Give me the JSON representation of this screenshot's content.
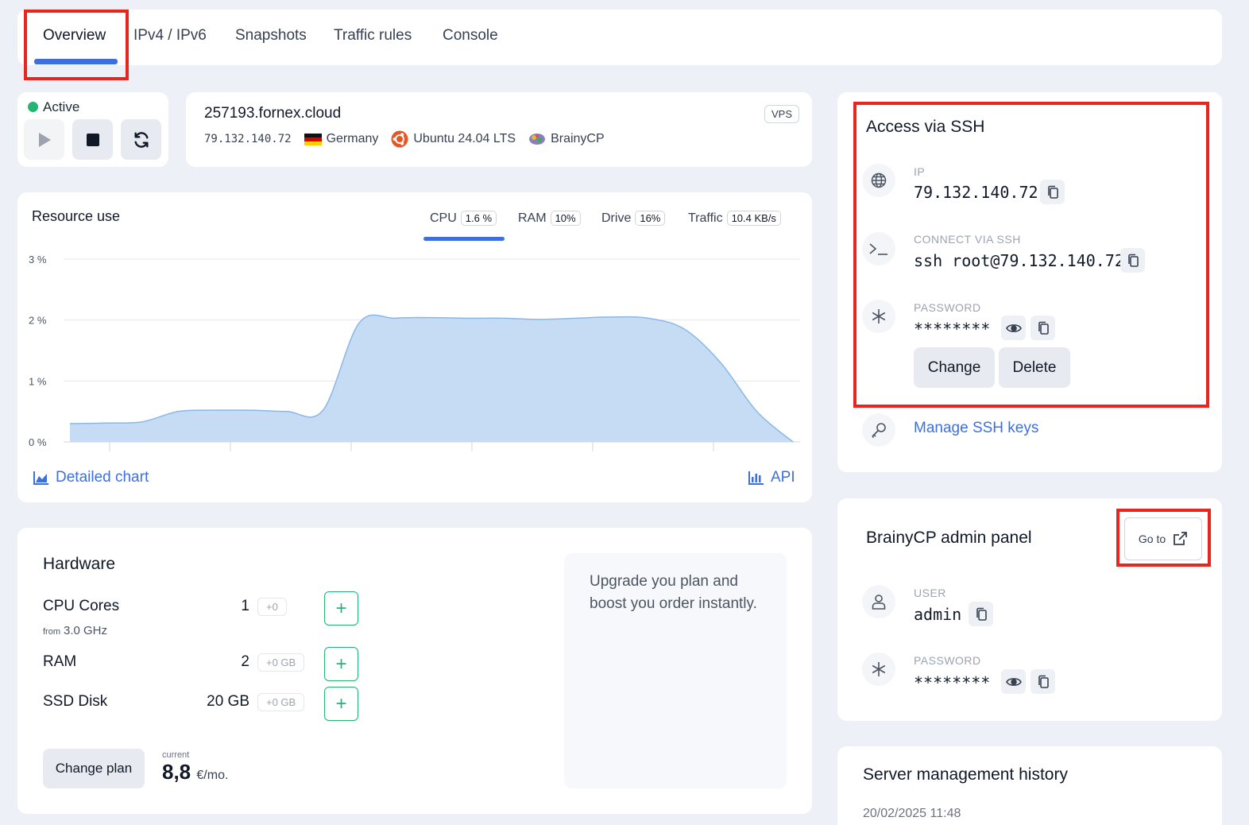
{
  "tabs": [
    {
      "label": "Overview",
      "active": true
    },
    {
      "label": "IPv4 / IPv6"
    },
    {
      "label": "Snapshots"
    },
    {
      "label": "Traffic rules"
    },
    {
      "label": "Console"
    }
  ],
  "status": {
    "label": "Active",
    "color": "#22b573"
  },
  "server": {
    "hostname": "257193.fornex.cloud",
    "badge": "VPS",
    "ip": "79.132.140.72",
    "country": "Germany",
    "os": "Ubuntu 24.04 LTS",
    "panel": "BrainyCP"
  },
  "resource": {
    "title": "Resource use",
    "metrics": [
      {
        "label": "CPU",
        "value": "1.6 %",
        "active": true
      },
      {
        "label": "RAM",
        "value": "10%"
      },
      {
        "label": "Drive",
        "value": "16%"
      },
      {
        "label": "Traffic",
        "value": "10.4 KB/s"
      }
    ],
    "detailed_link": "Detailed chart",
    "api_link": "API"
  },
  "chart_data": {
    "type": "area",
    "title": "",
    "xlabel": "",
    "ylabel": "",
    "y_ticks": [
      "0 %",
      "1 %",
      "2 %",
      "3 %"
    ],
    "ylim": [
      0,
      3
    ],
    "grid": true,
    "series": [
      {
        "values": [
          0.3,
          0.31,
          0.33,
          0.5,
          0.52,
          0.52,
          0.5,
          0.52,
          1.95,
          2.03,
          2.04,
          2.03,
          2.03,
          2.01,
          2.03,
          2.05,
          2.03,
          1.85,
          1.3,
          0.5,
          0.0
        ],
        "color": "#c6dcf4"
      }
    ]
  },
  "hardware": {
    "title": "Hardware",
    "rows": [
      {
        "label": "CPU Cores",
        "value": "1",
        "delta": "+0"
      },
      {
        "label": "RAM",
        "value": "2",
        "delta": "+0 GB"
      },
      {
        "label": "SSD Disk",
        "value": "20 GB",
        "delta": "+0 GB"
      }
    ],
    "cpu_sub_prefix": "from",
    "cpu_sub_value": "3.0 GHz",
    "upgrade_text": "Upgrade you plan and boost you order instantly.",
    "change_plan": "Change plan",
    "price_caption": "current",
    "price": "8,8",
    "price_unit": "€/mo."
  },
  "ssh": {
    "title": "Access via SSH",
    "ip_label": "IP",
    "ip_value": "79.132.140.72",
    "connect_label": "CONNECT VIA SSH",
    "connect_value": "ssh root@79.132.140.72",
    "password_label": "PASSWORD",
    "password_value": "********",
    "change_button": "Change",
    "delete_button": "Delete",
    "manage_keys": "Manage SSH keys"
  },
  "brainy": {
    "title": "BrainyCP admin panel",
    "goto": "Go to",
    "user_label": "USER",
    "user_value": "admin",
    "password_label": "PASSWORD",
    "password_value": "********"
  },
  "history": {
    "title": "Server management history",
    "first_date": "20/02/2025 11:48"
  }
}
